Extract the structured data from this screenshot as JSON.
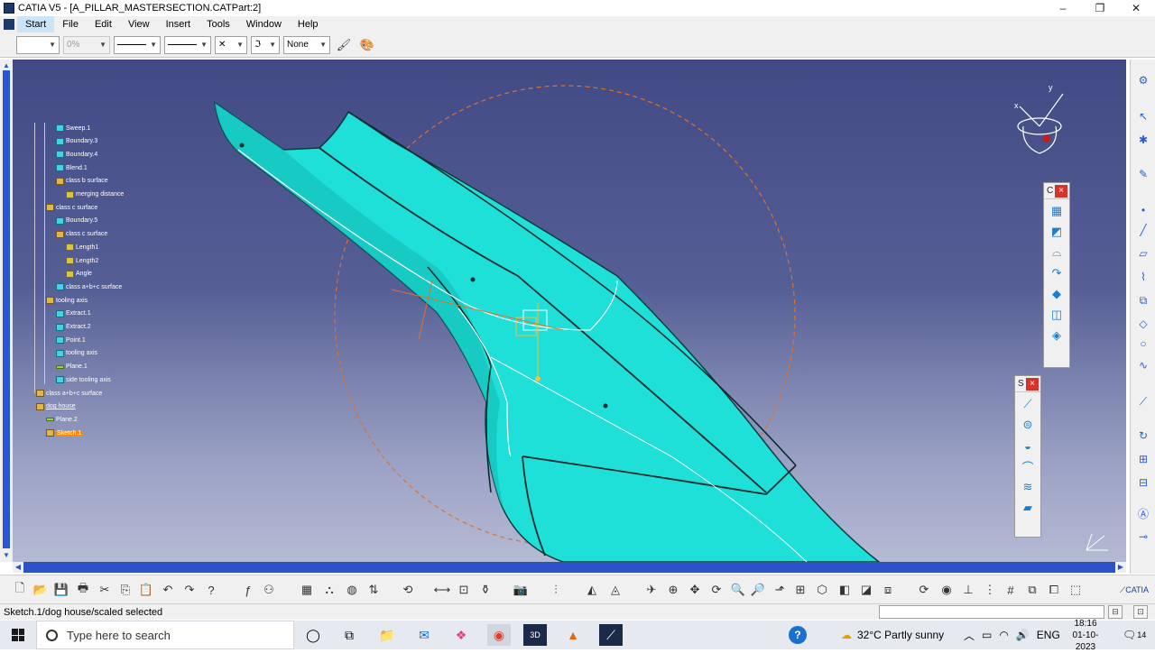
{
  "window": {
    "title": "CATIA V5 - [A_PILLAR_MASTERSECTION.CATPart:2]",
    "controls": [
      "–",
      "❐",
      "✕"
    ]
  },
  "menu": {
    "items": [
      "Start",
      "File",
      "Edit",
      "View",
      "Insert",
      "Tools",
      "Window",
      "Help"
    ],
    "active": "Start"
  },
  "properties": {
    "color_combo": "",
    "transparency": "0%",
    "linetype": "",
    "thickness": "",
    "point_symbol": "✕",
    "layer_icon": "ℑ",
    "layer": "None"
  },
  "tree": [
    {
      "label": "Sweep.1",
      "icon": "surface-icon"
    },
    {
      "label": "Boundary.3",
      "icon": "curve-icon"
    },
    {
      "label": "Boundary.4",
      "icon": "curve-icon"
    },
    {
      "label": "Blend.1",
      "icon": "surface-icon"
    },
    {
      "label": "class b surface",
      "icon": "set-icon"
    },
    {
      "label": "merging distance",
      "icon": "parameter-icon"
    },
    {
      "label": "class c surface",
      "icon": "set-icon"
    },
    {
      "label": "Boundary.5",
      "icon": "curve-icon"
    },
    {
      "label": "class c surface",
      "icon": "set-icon"
    },
    {
      "label": "Length1",
      "icon": "parameter-icon"
    },
    {
      "label": "Length2",
      "icon": "parameter-icon"
    },
    {
      "label": "Angle",
      "icon": "parameter-icon"
    },
    {
      "label": "class a+b+c surface",
      "icon": "surface-icon"
    },
    {
      "label": "tooling axis",
      "icon": "set-icon"
    },
    {
      "label": "Extract.1",
      "icon": "surface-icon"
    },
    {
      "label": "Extract.2",
      "icon": "surface-icon"
    },
    {
      "label": "Point.1",
      "icon": "point-icon"
    },
    {
      "label": "tooling axis",
      "icon": "line-icon"
    },
    {
      "label": "Plane.1",
      "icon": "plane-icon"
    },
    {
      "label": "side tooling axis",
      "icon": "line-icon"
    },
    {
      "label": "class a+b+c surface",
      "icon": "set-icon"
    },
    {
      "label": "dog house",
      "icon": "set-icon"
    },
    {
      "label": "Plane.2",
      "icon": "plane-icon"
    },
    {
      "label": "Sketch.1",
      "icon": "sketch-icon"
    }
  ],
  "compass": {
    "x_label": "x",
    "y_label": "y"
  },
  "floating_toolbars": [
    {
      "title": "C",
      "close": "×"
    },
    {
      "title": "S",
      "close": "×"
    }
  ],
  "status": {
    "message": "Sketch.1/dog house/scaled selected"
  },
  "taskbar": {
    "search_placeholder": "Type here to search",
    "weather": "32°C  Partly sunny",
    "language": "ENG",
    "time": "18:16",
    "date": "01-10-2023",
    "notifications": "14"
  },
  "colors": {
    "surface": "#1ee0d8",
    "background_top": "#424a85",
    "background_bottom": "#b5bad4",
    "scrollbar": "#2d52c8",
    "selection": "#ff8a00"
  }
}
